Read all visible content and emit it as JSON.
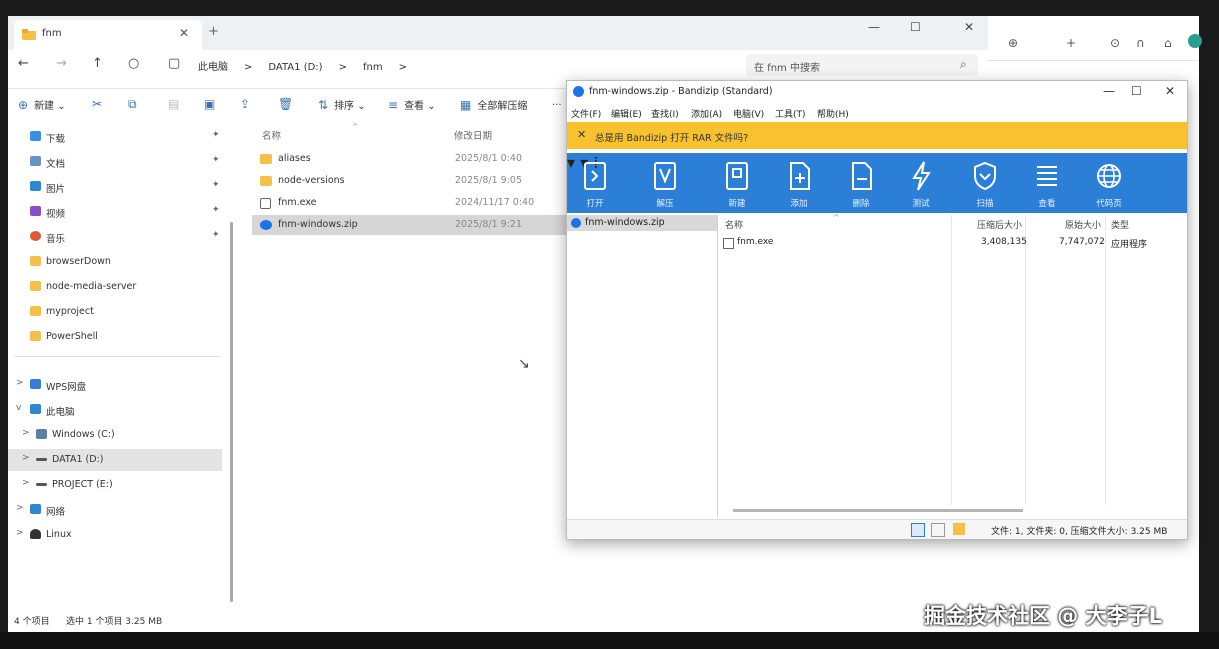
{
  "explorer": {
    "tab_title": "fnm",
    "new_tab": "+",
    "window_controls": {
      "minimize": "—",
      "maximize": "☐",
      "close": "✕"
    },
    "nav": {
      "back": "←",
      "forward": "→",
      "up": "↑",
      "refresh": "○",
      "display": "▢"
    },
    "breadcrumb": [
      "此电脑",
      ">",
      "DATA1 (D:)",
      ">",
      "fnm",
      ">"
    ],
    "search_placeholder": "在 fnm 中搜索",
    "toolbar": {
      "new": "新建",
      "sort": "排序",
      "view": "查看",
      "extract_all": "全部解压缩",
      "more": "..."
    },
    "sidebar": {
      "quick": [
        {
          "label": "下载",
          "pin": "✦"
        },
        {
          "label": "文档",
          "pin": "✦"
        },
        {
          "label": "图片",
          "pin": "✦"
        },
        {
          "label": "视频",
          "pin": "✦"
        },
        {
          "label": "音乐",
          "pin": "✦"
        },
        {
          "label": "browserDown",
          "pin": ""
        },
        {
          "label": "node-media-server",
          "pin": ""
        },
        {
          "label": "myproject",
          "pin": ""
        },
        {
          "label": "PowerShell",
          "pin": ""
        }
      ],
      "tree": [
        {
          "label": "WPS网盘",
          "chev": ">"
        },
        {
          "label": "此电脑",
          "chev": "v"
        },
        {
          "label": "Windows (C:)",
          "chev": ">"
        },
        {
          "label": "DATA1 (D:)",
          "chev": ">"
        },
        {
          "label": "PROJECT (E:)",
          "chev": ">"
        },
        {
          "label": "网络",
          "chev": ">"
        },
        {
          "label": "Linux",
          "chev": ">"
        }
      ]
    },
    "columns": {
      "name": "名称",
      "modified": "修改日期"
    },
    "files": [
      {
        "name": "aliases",
        "date": "2025/8/1 0:40",
        "type": "folder"
      },
      {
        "name": "node-versions",
        "date": "2025/8/1 9:05",
        "type": "folder"
      },
      {
        "name": "fnm.exe",
        "date": "2024/11/17 0:40",
        "type": "exe"
      },
      {
        "name": "fnm-windows.zip",
        "date": "2025/8/1 9:21",
        "type": "zip"
      }
    ],
    "status": {
      "count": "4 个项目",
      "selected": "选中 1 个项目 3.25 MB"
    }
  },
  "bandizip": {
    "title": "fnm-windows.zip - Bandizip (Standard)",
    "window_controls": {
      "minimize": "—",
      "maximize": "☐",
      "close": "✕"
    },
    "menu": [
      "文件(F)",
      "编辑(E)",
      "查找(I)",
      "添加(A)",
      "电脑(V)",
      "工具(T)",
      "帮助(H)"
    ],
    "notice": "总是用 Bandizip 打开 RAR 文件吗?",
    "notice_close": "✕",
    "tools": [
      {
        "label": "打开",
        "icon": "open-icon"
      },
      {
        "label": "解压",
        "icon": "extract-icon"
      },
      {
        "label": "新建",
        "icon": "new-archive-icon"
      },
      {
        "label": "添加",
        "icon": "add-icon"
      },
      {
        "label": "删除",
        "icon": "delete-icon"
      },
      {
        "label": "测试",
        "icon": "test-icon"
      },
      {
        "label": "扫描",
        "icon": "scan-shield-icon"
      },
      {
        "label": "查看",
        "icon": "view-list-icon"
      },
      {
        "label": "代码页",
        "icon": "codepage-globe-icon"
      }
    ],
    "tree_item": "fnm-windows.zip",
    "list_columns": {
      "name": "名称",
      "compressed": "压缩后大小",
      "original": "原始大小",
      "type": "类型"
    },
    "entries": [
      {
        "name": "fnm.exe",
        "compressed": "3,408,135",
        "original": "7,747,072",
        "type": "应用程序"
      }
    ],
    "status": "文件: 1, 文件夹: 0, 压缩文件大小: 3.25 MB"
  },
  "right_app": {
    "icons": [
      "⊕",
      "+",
      "⊙",
      "∩",
      "⌂"
    ]
  },
  "watermark": "掘金技术社区 @ 大李子L",
  "colors": {
    "accent": "#2b7fd6",
    "notice": "#f8c22f",
    "folder": "#f5c04a"
  }
}
